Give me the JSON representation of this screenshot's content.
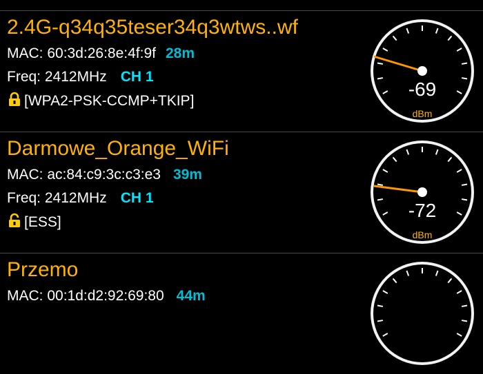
{
  "colors": {
    "ssid": "#ffb300",
    "distance": "#00bcd4",
    "channel": "#00e5ff",
    "lock": "#ffcc00",
    "needle": "#ff9800",
    "unit": "#ffb300"
  },
  "networks": [
    {
      "ssid": "",
      "mac": "",
      "distance": "",
      "freq": "",
      "channel": "",
      "security": "",
      "signal": "",
      "unit": "dBm"
    },
    {
      "ssid": "2.4G-q34q35teser34q3wtws..wf",
      "mac": "MAC: 60:3d:26:8e:4f:9f",
      "distance": "28m",
      "freq": "Freq: 2412MHz",
      "channel": "CH 1",
      "security": "[WPA2-PSK-CCMP+TKIP]",
      "security_icon": "lock-icon",
      "signal": "-69",
      "unit": "dBm"
    },
    {
      "ssid": "Darmowe_Orange_WiFi",
      "mac": "MAC: ac:84:c9:3c:c3:e3",
      "distance": "39m",
      "freq": "Freq: 2412MHz",
      "channel": "CH 1",
      "security": "[ESS]",
      "security_icon": "unlock-icon",
      "signal": "-72",
      "unit": "dBm"
    },
    {
      "ssid": "Przemo",
      "mac": "MAC: 00:1d:d2:92:69:80",
      "distance": "44m",
      "freq": "",
      "channel": "",
      "security": "",
      "signal": "",
      "unit": ""
    }
  ]
}
